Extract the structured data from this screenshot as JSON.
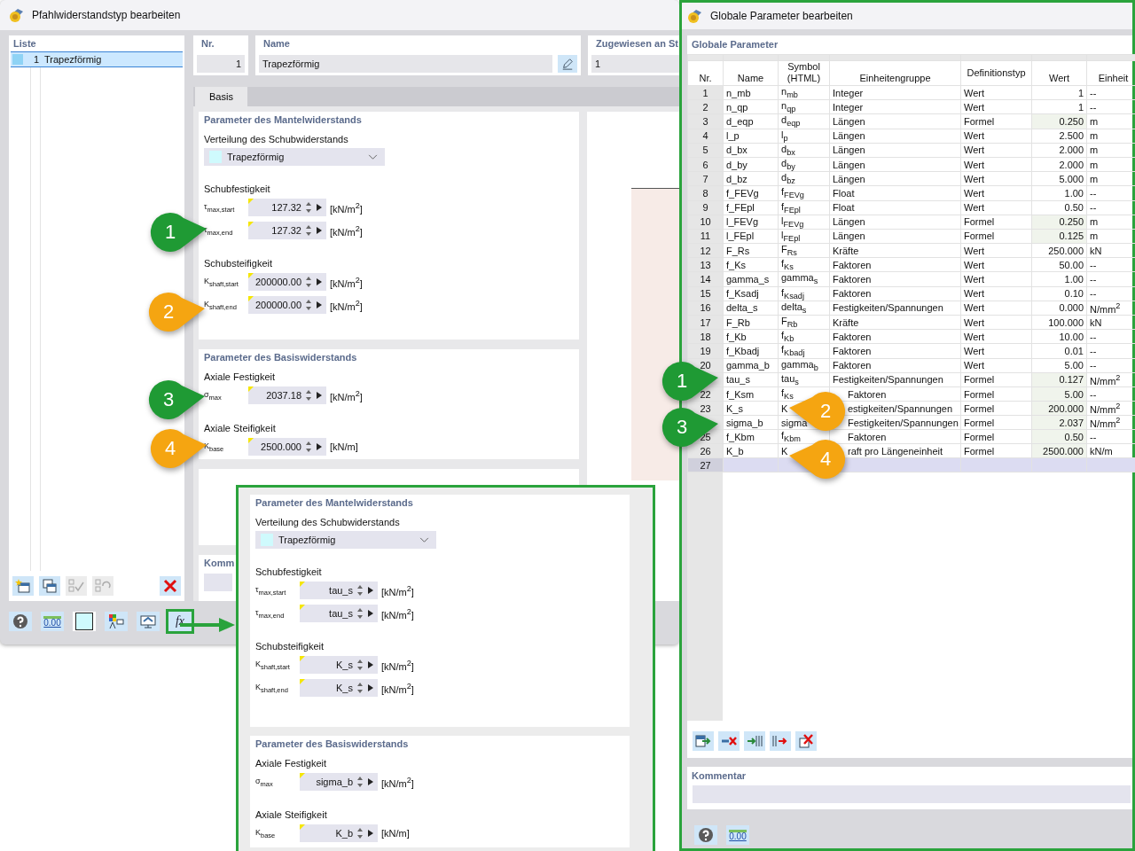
{
  "left_window": {
    "title": "Pfahlwiderstandstyp bearbeiten",
    "list": {
      "header": "Liste",
      "items": [
        {
          "nr": "1",
          "name": "Trapezförmig",
          "selected": true
        }
      ]
    },
    "list_tools": [
      {
        "kind": "new",
        "disabled": false
      },
      {
        "kind": "copy",
        "disabled": false
      },
      {
        "kind": "check-all",
        "disabled": true
      },
      {
        "kind": "check-toggle",
        "disabled": true
      },
      {
        "kind": "delete",
        "disabled": false
      }
    ],
    "nr": {
      "label": "Nr.",
      "value": "1"
    },
    "name": {
      "label": "Name",
      "value": "Trapezförmig"
    },
    "assigned": {
      "label": "Zugewiesen an St",
      "value": "1"
    },
    "tabs": [
      {
        "label": "Basis",
        "selected": true
      }
    ],
    "sections": [
      {
        "title": "Parameter des Mantelwiderstands",
        "groups": [
          {
            "kind": "dropdown",
            "label": "Verteilung des Schubwiderstands",
            "value": "Trapezförmig"
          },
          {
            "kind": "fields",
            "label": "Schubfestigkeit",
            "fields": [
              {
                "symbol": "τ$_{max,start}$",
                "value": "127.32",
                "unit": "[kN/m$^{2}$]"
              },
              {
                "symbol": "τ$_{max,end}$",
                "value": "127.32",
                "unit": "[kN/m$^{2}$]"
              }
            ]
          },
          {
            "kind": "fields",
            "label": "Schubsteifigkeit",
            "fields": [
              {
                "symbol": "K$_{shaft,start}$",
                "value": "200000.00",
                "unit": "[kN/m$^{2}$]"
              },
              {
                "symbol": "K$_{shaft,end}$",
                "value": "200000.00",
                "unit": "[kN/m$^{2}$]"
              }
            ]
          }
        ]
      },
      {
        "title": "Parameter des Basiswiderstands",
        "groups": [
          {
            "kind": "fields",
            "label": "Axiale Festigkeit",
            "fields": [
              {
                "symbol": "σ$_{max}$",
                "value": "2037.18",
                "unit": "[kN/m$^{2}$]"
              }
            ]
          },
          {
            "kind": "fields",
            "label": "Axiale Steifigkeit",
            "fields": [
              {
                "symbol": "K$_{base}$",
                "value": "2500.000",
                "unit": "[kN/m]"
              }
            ]
          }
        ]
      }
    ],
    "comment_label": "Komm",
    "toolbar": [
      {
        "kind": "help",
        "highlighted": false
      },
      {
        "kind": "decimals",
        "label": "0.00",
        "highlighted": false
      },
      {
        "kind": "color",
        "highlighted": false
      },
      {
        "kind": "legend",
        "highlighted": false
      },
      {
        "kind": "display",
        "highlighted": false
      },
      {
        "kind": "formula",
        "label": "fx",
        "highlighted": true
      }
    ]
  },
  "overlay_panel": {
    "sections": [
      {
        "title": "Parameter des Mantelwiderstands",
        "groups": [
          {
            "kind": "dropdown",
            "label": "Verteilung des Schubwiderstands",
            "value": "Trapezförmig"
          },
          {
            "kind": "fields",
            "label": "Schubfestigkeit",
            "fields": [
              {
                "symbol": "τ$_{max,start}$",
                "value": "tau_s",
                "unit": "[kN/m$^{2}$]"
              },
              {
                "symbol": "τ$_{max,end}$",
                "value": "tau_s",
                "unit": "[kN/m$^{2}$]"
              }
            ]
          },
          {
            "kind": "fields",
            "label": "Schubsteifigkeit",
            "fields": [
              {
                "symbol": "K$_{shaft,start}$",
                "value": "K_s",
                "unit": "[kN/m$^{2}$]"
              },
              {
                "symbol": "K$_{shaft,end}$",
                "value": "K_s",
                "unit": "[kN/m$^{2}$]"
              }
            ]
          }
        ]
      },
      {
        "title": "Parameter des Basiswiderstands",
        "groups": [
          {
            "kind": "fields",
            "label": "Axiale Festigkeit",
            "fields": [
              {
                "symbol": "σ$_{max}$",
                "value": "sigma_b",
                "unit": "[kN/m$^{2}$]"
              }
            ]
          },
          {
            "kind": "fields",
            "label": "Axiale Steifigkeit",
            "fields": [
              {
                "symbol": "K$_{base}$",
                "value": "K_b",
                "unit": "[kN/m]"
              }
            ]
          }
        ]
      }
    ]
  },
  "right_window": {
    "title": "Globale Parameter bearbeiten",
    "section_title": "Globale Parameter",
    "columns": [
      "Nr.",
      "Name",
      "Symbol (HTML)",
      "Einheitengruppe",
      "Definitionstyp",
      "Wert",
      "Einheit"
    ],
    "rows": [
      {
        "nr": "1",
        "name": "n_mb",
        "symbol": "n$_{mb}$",
        "group": "Integer",
        "deftype": "Wert",
        "value": "1",
        "unit": "--",
        "formula": false,
        "selected": false
      },
      {
        "nr": "2",
        "name": "n_qp",
        "symbol": "n$_{qp}$",
        "group": "Integer",
        "deftype": "Wert",
        "value": "1",
        "unit": "--",
        "formula": false,
        "selected": false
      },
      {
        "nr": "3",
        "name": "d_eqp",
        "symbol": "d$_{eqp}$",
        "group": "Längen",
        "deftype": "Formel",
        "value": "0.250",
        "unit": "m",
        "formula": true,
        "selected": false
      },
      {
        "nr": "4",
        "name": "l_p",
        "symbol": "l$_{p}$",
        "group": "Längen",
        "deftype": "Wert",
        "value": "2.500",
        "unit": "m",
        "formula": false,
        "selected": false
      },
      {
        "nr": "5",
        "name": "d_bx",
        "symbol": "d$_{bx}$",
        "group": "Längen",
        "deftype": "Wert",
        "value": "2.000",
        "unit": "m",
        "formula": false,
        "selected": false
      },
      {
        "nr": "6",
        "name": "d_by",
        "symbol": "d$_{by}$",
        "group": "Längen",
        "deftype": "Wert",
        "value": "2.000",
        "unit": "m",
        "formula": false,
        "selected": false
      },
      {
        "nr": "7",
        "name": "d_bz",
        "symbol": "d$_{bz}$",
        "group": "Längen",
        "deftype": "Wert",
        "value": "5.000",
        "unit": "m",
        "formula": false,
        "selected": false
      },
      {
        "nr": "8",
        "name": "f_FEVg",
        "symbol": "f$_{FEVg}$",
        "group": "Float",
        "deftype": "Wert",
        "value": "1.00",
        "unit": "--",
        "formula": false,
        "selected": false
      },
      {
        "nr": "9",
        "name": "f_FEpl",
        "symbol": "f$_{FEpl}$",
        "group": "Float",
        "deftype": "Wert",
        "value": "0.50",
        "unit": "--",
        "formula": false,
        "selected": false
      },
      {
        "nr": "10",
        "name": "l_FEVg",
        "symbol": "l$_{FEVg}$",
        "group": "Längen",
        "deftype": "Formel",
        "value": "0.250",
        "unit": "m",
        "formula": true,
        "selected": false
      },
      {
        "nr": "11",
        "name": "l_FEpl",
        "symbol": "l$_{FEpl}$",
        "group": "Längen",
        "deftype": "Formel",
        "value": "0.125",
        "unit": "m",
        "formula": true,
        "selected": false
      },
      {
        "nr": "12",
        "name": "F_Rs",
        "symbol": "F$_{Rs}$",
        "group": "Kräfte",
        "deftype": "Wert",
        "value": "250.000",
        "unit": "kN",
        "formula": false,
        "selected": false
      },
      {
        "nr": "13",
        "name": "f_Ks",
        "symbol": "f$_{Ks}$",
        "group": "Faktoren",
        "deftype": "Wert",
        "value": "50.00",
        "unit": "--",
        "formula": false,
        "selected": false
      },
      {
        "nr": "14",
        "name": "gamma_s",
        "symbol": "gamma$_{s}$",
        "group": "Faktoren",
        "deftype": "Wert",
        "value": "1.00",
        "unit": "--",
        "formula": false,
        "selected": false
      },
      {
        "nr": "15",
        "name": "f_Ksadj",
        "symbol": "f$_{Ksadj}$",
        "group": "Faktoren",
        "deftype": "Wert",
        "value": "0.10",
        "unit": "--",
        "formula": false,
        "selected": false
      },
      {
        "nr": "16",
        "name": "delta_s",
        "symbol": "delta$_{s}$",
        "group": "Festigkeiten/Spannungen",
        "deftype": "Wert",
        "value": "0.000",
        "unit": "N/mm$^{2}$",
        "formula": false,
        "selected": false
      },
      {
        "nr": "17",
        "name": "F_Rb",
        "symbol": "F$_{Rb}$",
        "group": "Kräfte",
        "deftype": "Wert",
        "value": "100.000",
        "unit": "kN",
        "formula": false,
        "selected": false
      },
      {
        "nr": "18",
        "name": "f_Kb",
        "symbol": "f$_{Kb}$",
        "group": "Faktoren",
        "deftype": "Wert",
        "value": "10.00",
        "unit": "--",
        "formula": false,
        "selected": false
      },
      {
        "nr": "19",
        "name": "f_Kbadj",
        "symbol": "f$_{Kbadj}$",
        "group": "Faktoren",
        "deftype": "Wert",
        "value": "0.01",
        "unit": "--",
        "formula": false,
        "selected": false
      },
      {
        "nr": "20",
        "name": "gamma_b",
        "symbol": "gamma$_{b}$",
        "group": "Faktoren",
        "deftype": "Wert",
        "value": "5.00",
        "unit": "--",
        "formula": false,
        "selected": false
      },
      {
        "name": "tau_s",
        "symbol": "tau$_{s}$",
        "group": "Festigkeiten/Spannungen",
        "deftype": "Formel",
        "value": "0.127",
        "unit": "N/mm$^{2}$",
        "formula": true,
        "selected": false
      },
      {
        "nr": "22",
        "name": "f_Ksm",
        "symbol": "f$_{Ks}$",
        "group": "Faktoren",
        "deftype": "Formel",
        "value": "5.00",
        "unit": "--",
        "formula": true,
        "selected": false
      },
      {
        "nr": "23",
        "name": "K_s",
        "symbol": "K",
        "group": "estigkeiten/Spannungen",
        "deftype": "Formel",
        "value": "200.000",
        "unit": "N/mm$^{2}$",
        "formula": true,
        "selected": false
      },
      {
        "name": "sigma_b",
        "symbol": "sigma",
        "group": "Festigkeiten/Spannungen",
        "deftype": "Formel",
        "value": "2.037",
        "unit": "N/mm$^{2}$",
        "formula": true,
        "selected": false
      },
      {
        "nr": "25",
        "name": "f_Kbm",
        "symbol": "f$_{Kbm}$",
        "group": "Faktoren",
        "deftype": "Formel",
        "value": "0.50",
        "unit": "--",
        "formula": true,
        "selected": false
      },
      {
        "nr": "26",
        "name": "K_b",
        "symbol": "K",
        "group": "raft pro Längeneinheit",
        "deftype": "Formel",
        "value": "2500.000",
        "unit": "kN/m",
        "formula": true,
        "selected": false
      },
      {
        "nr": "27",
        "selected": true
      }
    ],
    "table_tools": [
      {
        "kind": "insert"
      },
      {
        "kind": "delete-row"
      },
      {
        "kind": "import"
      },
      {
        "kind": "export"
      },
      {
        "kind": "delete-all"
      }
    ],
    "comment_label": "Kommentar",
    "toolbar": [
      {
        "kind": "help"
      },
      {
        "kind": "decimals",
        "label": "0.00"
      }
    ]
  },
  "callouts": [
    {
      "label": "1",
      "color": "#1f9a34",
      "kind": "right"
    },
    {
      "label": "2",
      "color": "#f5a511",
      "kind": "right"
    },
    {
      "label": "3",
      "color": "#1f9a34",
      "kind": "right"
    },
    {
      "label": "4",
      "color": "#f5a511",
      "kind": "right"
    },
    {
      "label": "1",
      "color": "#1f9a34",
      "kind": "right"
    },
    {
      "label": "2",
      "color": "#f5a511",
      "kind": "left"
    },
    {
      "label": "3",
      "color": "#1f9a34",
      "kind": "right"
    },
    {
      "label": "4",
      "color": "#f5a511",
      "kind": "left"
    }
  ]
}
